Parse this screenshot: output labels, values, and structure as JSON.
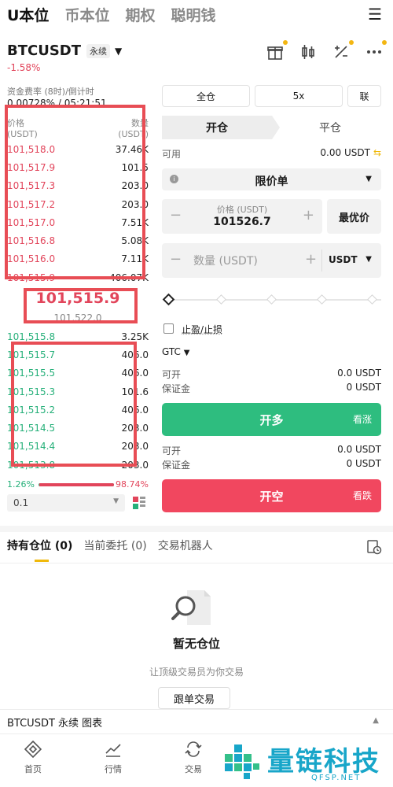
{
  "top_tabs": [
    "U本位",
    "币本位",
    "期权",
    "聪明钱"
  ],
  "menu_icon": "☰",
  "symbol": "BTCUSDT",
  "badge": "永续",
  "change": "-1.58%",
  "funding": {
    "label": "资金费率 (8时)/倒计时",
    "value": "0.00728% / 05:21:51"
  },
  "orderbook": {
    "price_header": "价格",
    "price_unit": "(USDT)",
    "qty_header": "数量",
    "qty_unit": "(USDT)",
    "asks": [
      {
        "price": "101,518.0",
        "qty": "37.46K"
      },
      {
        "price": "101,517.9",
        "qty": "101.5"
      },
      {
        "price": "101,517.3",
        "qty": "203.0"
      },
      {
        "price": "101,517.2",
        "qty": "203.0"
      },
      {
        "price": "101,517.0",
        "qty": "7.51K"
      },
      {
        "price": "101,516.8",
        "qty": "5.08K"
      },
      {
        "price": "101,516.0",
        "qty": "7.11K"
      },
      {
        "price": "101,515.9",
        "qty": "406.07K"
      }
    ],
    "last_price": "101,515.9",
    "mark_price": "101,522.0",
    "bids": [
      {
        "price": "101,515.8",
        "qty": "3.25K"
      },
      {
        "price": "101,515.7",
        "qty": "406.0"
      },
      {
        "price": "101,515.5",
        "qty": "406.0"
      },
      {
        "price": "101,515.3",
        "qty": "101.6"
      },
      {
        "price": "101,515.2",
        "qty": "406.0"
      },
      {
        "price": "101,514.5",
        "qty": "203.0"
      },
      {
        "price": "101,514.4",
        "qty": "203.0"
      },
      {
        "price": "101,513.8",
        "qty": "203.0"
      }
    ],
    "ask_depth_fractions": [
      0.95,
      0.72,
      0.72,
      0.72,
      0.72,
      0.72,
      0.72,
      0.72
    ],
    "bid_depth_fractions": [
      0.3,
      0.1,
      0.1,
      0.1,
      0.1,
      0.1,
      0.1,
      0.1
    ],
    "buy_ratio": "1.26%",
    "sell_ratio": "98.74%",
    "sell_ratio_fraction": 0.9874,
    "depth_step": "0.1"
  },
  "controls": {
    "margin_mode": "全仓",
    "leverage": "5x",
    "asset_mode": "联",
    "open_tab": "开仓",
    "close_tab": "平仓",
    "available_label": "可用",
    "available_value": "0.00 USDT",
    "order_type": "限价单",
    "price_label": "价格 (USDT)",
    "price_value": "101526.7",
    "best_price": "最优价",
    "qty_placeholder": "数量 (USDT)",
    "qty_unit": "USDT",
    "tpsl": "止盈/止损",
    "tif": "GTC",
    "long_info": [
      {
        "label": "可开",
        "value": "0.0 USDT"
      },
      {
        "label": "保证金",
        "value": "0 USDT"
      }
    ],
    "long_button": "开多",
    "long_sub": "看涨",
    "short_info": [
      {
        "label": "可开",
        "value": "0.0 USDT"
      },
      {
        "label": "保证金",
        "value": "0 USDT"
      }
    ],
    "short_button": "开空",
    "short_sub": "看跌"
  },
  "positions": {
    "tab_holdings": "持有仓位 (0)",
    "tab_orders": "当前委托 (0)",
    "tab_bots": "交易机器人",
    "empty_title": "暂无仓位",
    "empty_sub": "让顶级交易员为你交易",
    "copy_button": "跟单交易"
  },
  "chart_bar": "BTCUSDT 永续  图表",
  "bottom_nav": [
    "首页",
    "行情",
    "交易"
  ],
  "watermark": {
    "cn": "量链科技",
    "en": "QFSP.NET"
  },
  "colors": {
    "ask": "#e2455b",
    "bid": "#27b07a",
    "accent": "#f0b90b",
    "long": "#2ebd7f",
    "short": "#f1475f",
    "annotation": "#e84d55"
  }
}
